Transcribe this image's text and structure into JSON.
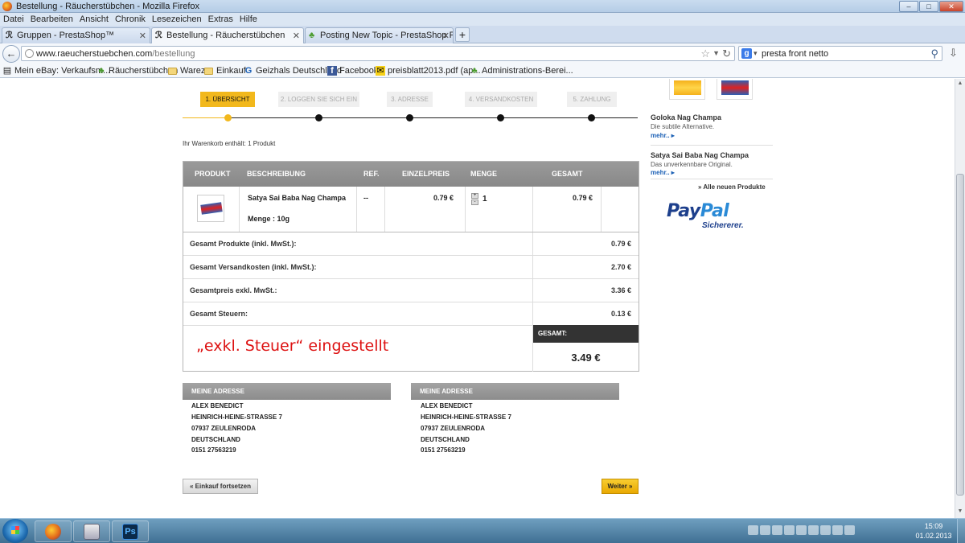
{
  "window": {
    "title": "Bestellung - Räucherstübchen - Mozilla Firefox",
    "buttons": [
      "–",
      "□",
      "✕"
    ]
  },
  "menu": [
    "Datei",
    "Bearbeiten",
    "Ansicht",
    "Chronik",
    "Lesezeichen",
    "Extras",
    "Hilfe"
  ],
  "tabs": [
    {
      "label": "Gruppen - PrestaShop™",
      "icon": "R"
    },
    {
      "label": "Bestellung - Räucherstübchen",
      "icon": "R"
    },
    {
      "label": "Posting New Topic - PrestaShop Foru...",
      "icon": "leaf"
    }
  ],
  "nav": {
    "url_domain": "www.raeucherstuebchen.com",
    "url_path": "/bestellung",
    "search_query": "presta front netto"
  },
  "bookmarks": [
    "Mein eBay: Verkaufsm...",
    "Räucherstübchen",
    "Warez",
    "Einkauf",
    "Geizhals Deutschland",
    "Facebook",
    "preisblatt2013.pdf (ap...",
    "Administrations-Berei..."
  ],
  "steps": [
    "1. ÜBERSICHT",
    "2. LOGGEN SIE SICH EIN",
    "3. ADRESSE",
    "4. VERSANDKOSTEN",
    "5. ZAHLUNG"
  ],
  "cart": {
    "info": "Ihr Warenkorb enthält: 1 Produkt",
    "headers": [
      "PRODUKT",
      "BESCHREIBUNG",
      "REF.",
      "EINZELPREIS",
      "MENGE",
      "GESAMT"
    ],
    "item": {
      "name": "Satya Sai Baba Nag Champa",
      "variant": "Menge : 10g",
      "ref": "--",
      "unit_price": "0.79 €",
      "quantity": "1",
      "total": "0.79 €"
    },
    "summary": [
      {
        "label": "Gesamt Produkte (inkl. MwSt.):",
        "value": "0.79 €"
      },
      {
        "label": "Gesamt Versandkosten (inkl. MwSt.):",
        "value": "2.70 €"
      },
      {
        "label": "Gesamtpreis exkl. MwSt.:",
        "value": "3.36 €"
      },
      {
        "label": "Gesamt Steuern:",
        "value": "0.13 €"
      }
    ],
    "total_label": "GESAMT:",
    "total_value": "3.49 €",
    "annotation": "„exkl. Steuer“ eingestellt"
  },
  "addresses": [
    {
      "heading": "MEINE ADRESSE",
      "lines": [
        "ALEX BENEDICT",
        "HEINRICH-HEINE-STRASSE 7",
        "07937 ZEULENRODA",
        "DEUTSCHLAND",
        "0151 27563219"
      ]
    },
    {
      "heading": "MEINE ADRESSE",
      "lines": [
        "ALEX BENEDICT",
        "HEINRICH-HEINE-STRASSE 7",
        "07937 ZEULENRODA",
        "DEUTSCHLAND",
        "0151 27563219"
      ]
    }
  ],
  "buttons": {
    "continue": "« Einkauf fortsetzen",
    "next": "Weiter »"
  },
  "sidebar": {
    "new_products": [
      {
        "name": "Goloka Nag Champa",
        "desc": "Die subtile Alternative.",
        "more": "mehr.. ▸"
      },
      {
        "name": "Satya Sai Baba Nag Champa",
        "desc": "Das unverkennbare Original.",
        "more": "mehr.. ▸"
      }
    ],
    "all_new": "» Alle neuen Produkte",
    "paypal_pay": "Pay",
    "paypal_pal": "Pal",
    "paypal_sub": "Sichererer."
  },
  "taskbar": {
    "time": "15:09",
    "date": "01.02.2013"
  }
}
